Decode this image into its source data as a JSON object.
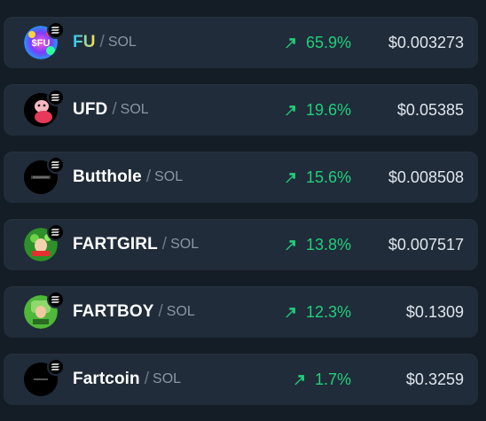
{
  "colors": {
    "background": "#141c25",
    "row": "#202c39",
    "up": "#1ed07d",
    "fu_gradient": [
      "#1ec8ff",
      "#ffe14d"
    ]
  },
  "pairs": [
    {
      "symbol": "FU",
      "quote": "SOL",
      "change": "65.9%",
      "price": "$0.003273",
      "avatar_icon": "fu-token-icon"
    },
    {
      "symbol": "UFD",
      "quote": "SOL",
      "change": "19.6%",
      "price": "$0.05385",
      "avatar_icon": "ufd-token-icon"
    },
    {
      "symbol": "Butthole",
      "quote": "SOL",
      "change": "15.6%",
      "price": "$0.008508",
      "avatar_icon": "butthole-token-icon"
    },
    {
      "symbol": "FARTGIRL",
      "quote": "SOL",
      "change": "13.8%",
      "price": "$0.007517",
      "avatar_icon": "fartgirl-token-icon"
    },
    {
      "symbol": "FARTBOY",
      "quote": "SOL",
      "change": "12.3%",
      "price": "$0.1309",
      "avatar_icon": "fartboy-token-icon"
    },
    {
      "symbol": "Fartcoin",
      "quote": "SOL",
      "change": "1.7%",
      "price": "$0.3259",
      "avatar_icon": "fartcoin-token-icon"
    }
  ],
  "avatar_texts": {
    "fu": "$FU"
  }
}
